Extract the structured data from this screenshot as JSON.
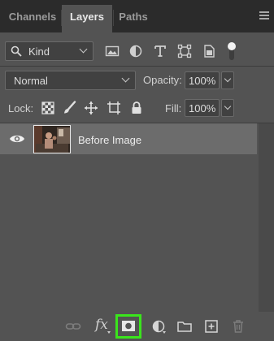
{
  "tabs": [
    {
      "label": "Channels",
      "active": false
    },
    {
      "label": "Layers",
      "active": true
    },
    {
      "label": "Paths",
      "active": false
    }
  ],
  "filter": {
    "kind_label": "Kind",
    "icons": [
      "image-filter-icon",
      "adjustment-filter-icon",
      "type-filter-icon",
      "shape-filter-icon",
      "smart-object-filter-icon",
      "filter-toggle-icon"
    ]
  },
  "blend": {
    "mode": "Normal"
  },
  "opacity": {
    "label": "Opacity:",
    "value": "100%"
  },
  "lock": {
    "label": "Lock:",
    "icons": [
      "lock-transparent-pixels-icon",
      "lock-image-pixels-icon",
      "lock-position-icon",
      "lock-artboard-icon",
      "lock-all-icon"
    ]
  },
  "fill": {
    "label": "Fill:",
    "value": "100%"
  },
  "layers": [
    {
      "name": "Before Image",
      "visible": true,
      "selected": true
    }
  ],
  "bottom_bar": {
    "fx_label": "fx",
    "highlight_color": "#3ae51c"
  },
  "colors": {
    "panel_bg": "#535353",
    "tabbar_bg": "#2b2b2b",
    "selected_row": "#6c6c6c"
  }
}
